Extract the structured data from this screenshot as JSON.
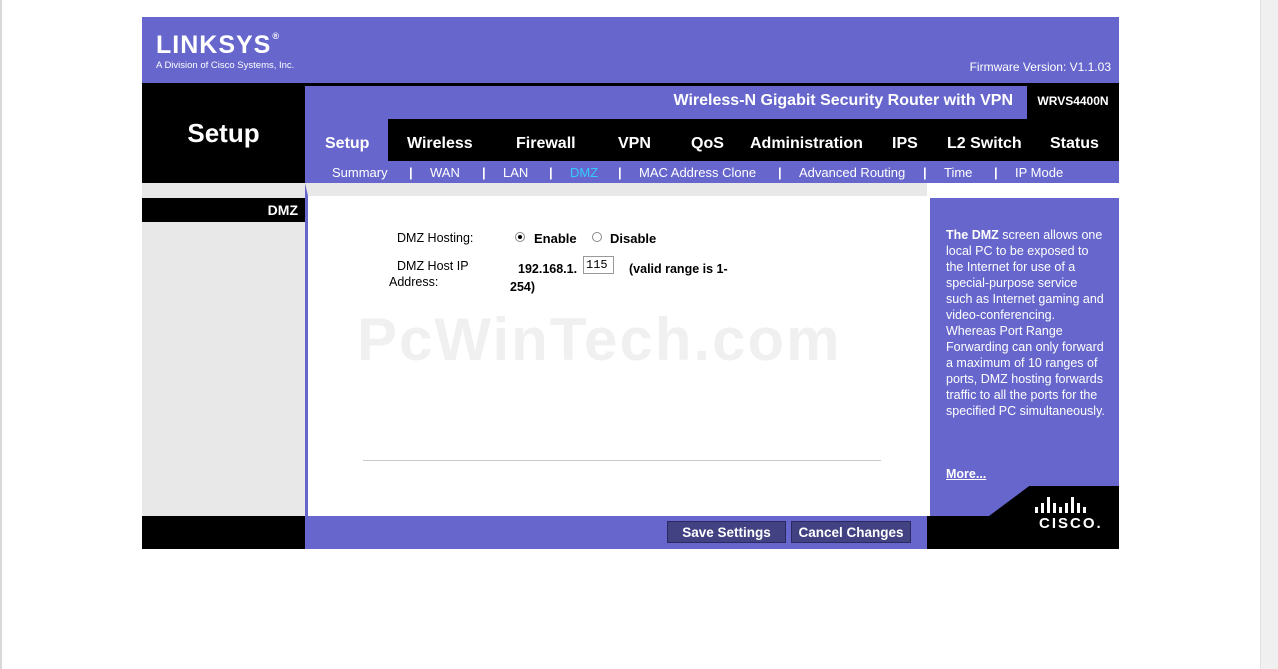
{
  "header": {
    "brand": "LINKSYS",
    "brand_reg": "®",
    "brand_sub": "A Division of Cisco Systems, Inc.",
    "firmware": "Firmware Version: V1.1.03"
  },
  "section": {
    "title": "Setup",
    "sub_title": "DMZ"
  },
  "product": {
    "name": "Wireless-N Gigabit Security Router with VPN",
    "model": "WRVS4400N"
  },
  "tabs": [
    {
      "label": "Setup"
    },
    {
      "label": "Wireless"
    },
    {
      "label": "Firewall"
    },
    {
      "label": "VPN"
    },
    {
      "label": "QoS"
    },
    {
      "label": "Administration"
    },
    {
      "label": "IPS"
    },
    {
      "label": "L2 Switch"
    },
    {
      "label": "Status"
    }
  ],
  "subnav": {
    "items": [
      {
        "label": "Summary"
      },
      {
        "label": "WAN"
      },
      {
        "label": "LAN"
      },
      {
        "label": "DMZ"
      },
      {
        "label": "MAC Address Clone"
      },
      {
        "label": "Advanced Routing"
      },
      {
        "label": "Time"
      },
      {
        "label": "IP Mode"
      }
    ],
    "separator": "|"
  },
  "form": {
    "dmz_hosting_label": "DMZ Hosting:",
    "enable_label": "Enable",
    "disable_label": "Disable",
    "host_ip_label_1": "DMZ Host IP",
    "host_ip_label_2": "Address:",
    "ip_prefix": "192.168.1.",
    "ip_last": "115",
    "range_1": "(valid range is 1-",
    "range_2": "254)"
  },
  "watermark": "PcWinTech.com",
  "help": {
    "bold": "The DMZ",
    "text": " screen allows one local PC to be exposed to the Internet for use of a special-purpose service such as Internet gaming and video-conferencing. Whereas Port Range Forwarding can only forward a maximum of 10 ranges of ports, DMZ hosting forwards traffic to all the ports for the specified PC simultaneously.",
    "more": "More..."
  },
  "buttons": {
    "save": "Save Settings",
    "cancel": "Cancel Changes"
  },
  "cisco": "CISCO."
}
